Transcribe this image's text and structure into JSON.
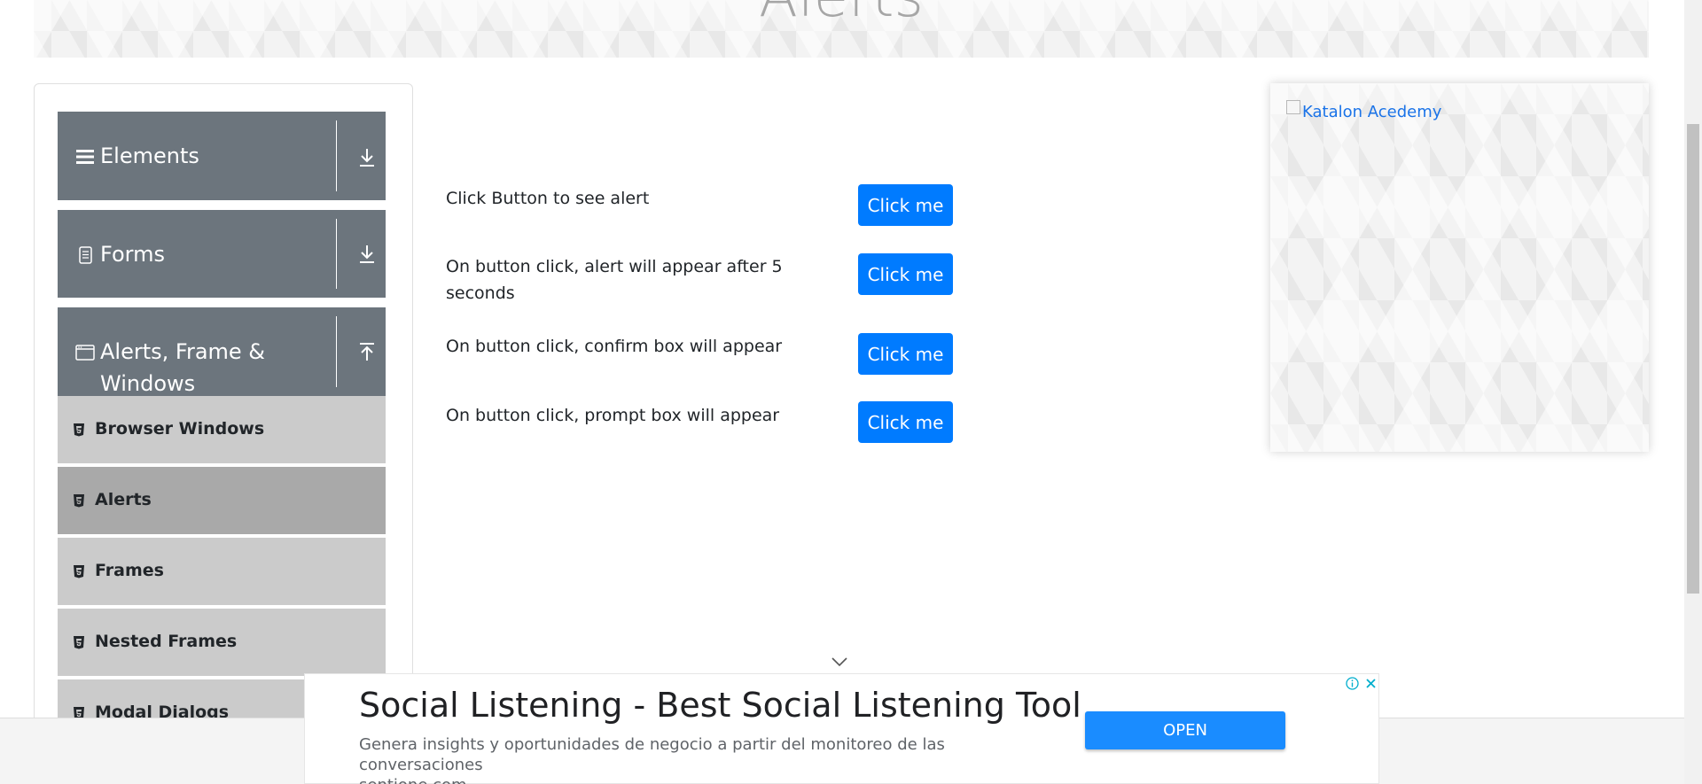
{
  "banner": {
    "title": "Alerts"
  },
  "sidebar": {
    "groups": [
      {
        "label": "Elements",
        "icon": "menu-icon",
        "toggle_icon": "download-icon"
      },
      {
        "label": "Forms",
        "icon": "document-icon",
        "toggle_icon": "download-icon"
      },
      {
        "label_line1": "Alerts, Frame &",
        "label_line2": "Windows",
        "icon": "window-icon",
        "toggle_icon": "upload-icon"
      }
    ],
    "items": [
      {
        "label": "Browser Windows",
        "icon": "html5-icon",
        "active": false
      },
      {
        "label": "Alerts",
        "icon": "html5-icon",
        "active": true
      },
      {
        "label": "Frames",
        "icon": "html5-icon",
        "active": false
      },
      {
        "label": "Nested Frames",
        "icon": "html5-icon",
        "active": false
      },
      {
        "label": "Modal Dialogs",
        "icon": "html5-icon",
        "active": false
      }
    ]
  },
  "main": {
    "rows": [
      {
        "label": "Click Button to see alert",
        "button": "Click me"
      },
      {
        "label": "On button click, alert will appear after 5 seconds",
        "button": "Click me"
      },
      {
        "label": "On button click, confirm box will appear",
        "button": "Click me"
      },
      {
        "label": "On button click, prompt box will appear",
        "button": "Click me"
      }
    ]
  },
  "side_ad": {
    "alt_text": "Katalon Acedemy"
  },
  "bottom_ad": {
    "headline": "Social Listening - Best Social Listening Tool",
    "description": "Genera insights y oportunidades de negocio a partir del monitoreo de las conversaciones",
    "domain": "sentione.com",
    "cta": "OPEN"
  },
  "colors": {
    "primary_button": "#007bff",
    "sidebar_header": "#6c757d",
    "sidebar_item": "#cbcbcb",
    "sidebar_item_active": "#a9a9a9",
    "ad_cta": "#1a8cff"
  }
}
